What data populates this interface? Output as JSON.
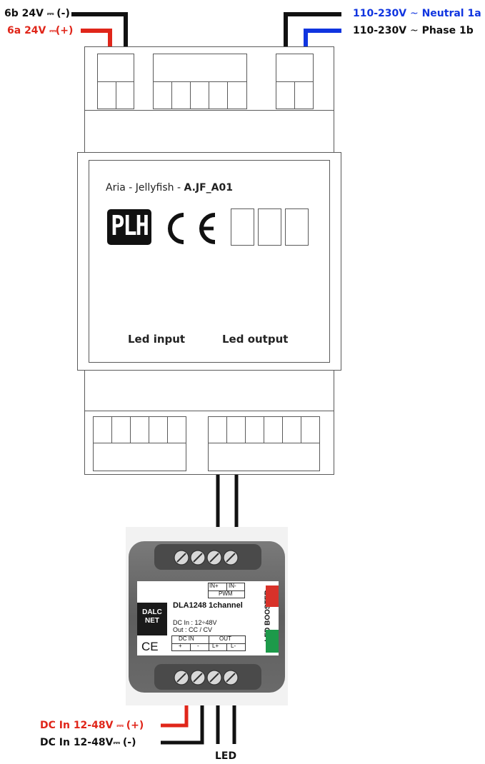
{
  "wire_labels": {
    "neg_24v": {
      "prefix": "6b 24V ",
      "symbol": "⎓",
      "suffix": " (-)",
      "color": "#111111"
    },
    "pos_24v": {
      "prefix": "6a 24V ",
      "symbol": "⎓",
      "suffix": "(+)",
      "color": "#e0261a"
    },
    "neutral": {
      "prefix": "110-230V ",
      "tilde": "~",
      "suffix": " Neutral 1a",
      "color": "#1035e0"
    },
    "phase": {
      "prefix": "110-230V ",
      "tilde": "~",
      "suffix": " Phase 1b",
      "color": "#111111"
    },
    "dc_pos": {
      "prefix": "DC In 12-48V ",
      "symbol": "⎓",
      "suffix": " (+)",
      "color": "#e0261a"
    },
    "dc_neg": {
      "prefix": "DC In  12-48V",
      "symbol": "⎓",
      "suffix": " (-)",
      "color": "#111111"
    },
    "led": "LED"
  },
  "module": {
    "name_prefix": "Aria - Jellyfish - ",
    "name_code": "A.JF_A01",
    "logo_text": "PLH",
    "ce_mark": "CE",
    "led_input": "Led input",
    "led_output": "Led output"
  },
  "booster": {
    "brand_line1": "DALC",
    "brand_line2": "NET",
    "ce_mark": "CE",
    "in_plus": "IN+",
    "in_minus": "IN-",
    "pwm": "PWM",
    "model": "DLA1248 1channel",
    "spec_line1": "DC In : 12÷48V",
    "spec_line2": "Out : CC / CV",
    "dc_in": "DC IN",
    "out": "OUT",
    "plus": "+",
    "minus": "-",
    "l_plus": "L+",
    "l_minus": "L-",
    "side_label": "LED BOOSTER"
  },
  "colors": {
    "black_wire": "#111111",
    "red_wire": "#e0261a",
    "blue_wire": "#1035e0"
  }
}
